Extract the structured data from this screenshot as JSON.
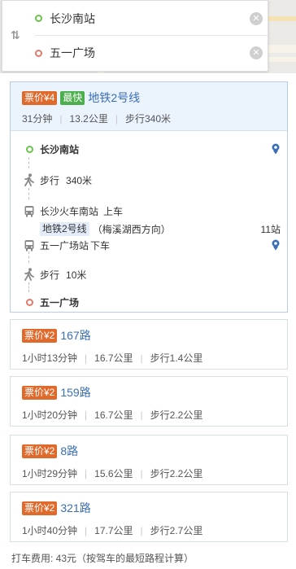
{
  "search": {
    "origin": "长沙南站",
    "destination": "五一广场"
  },
  "selected_route": {
    "price": "票价¥4",
    "fast_tag": "最快",
    "name": "地铁2号线",
    "duration": "31分钟",
    "distance": "13.2公里",
    "walk": "步行340米",
    "steps": {
      "start": "长沙南站",
      "walk1_label": "步行",
      "walk1_dist": "340米",
      "board_station": "长沙火车南站",
      "board_action": "上车",
      "line": "地铁2号线",
      "direction": "（梅溪湖西方向）",
      "stops": "11站",
      "alight_station": "五一广场站",
      "alight_action": "下车",
      "walk2_label": "步行",
      "walk2_dist": "10米",
      "end": "五一广场"
    }
  },
  "routes": [
    {
      "price": "票价¥2",
      "name": "167路",
      "duration": "1小时13分钟",
      "distance": "16.7公里",
      "walk": "步行1.4公里"
    },
    {
      "price": "票价¥2",
      "name": "159路",
      "duration": "1小时20分钟",
      "distance": "16.7公里",
      "walk": "步行2.2公里"
    },
    {
      "price": "票价¥2",
      "name": "8路",
      "duration": "1小时29分钟",
      "distance": "15.6公里",
      "walk": "步行2.2公里"
    },
    {
      "price": "票价¥2",
      "name": "321路",
      "duration": "1小时40分钟",
      "distance": "17.7公里",
      "walk": "步行2.7公里"
    }
  ],
  "taxi_fare": "打车费用: 43元（按驾车的最短路程计算）",
  "icons": {
    "swap": "swap-icon",
    "clear": "clear-icon",
    "walk": "walk-icon",
    "bus": "bus-icon",
    "pin": "location-pin-icon"
  },
  "colors": {
    "price_badge": "#e06a2c",
    "fast_badge": "#4cae4c",
    "link_blue": "#3a6eb5",
    "origin_green": "#6cc24a",
    "destination_red": "#e07a6b"
  }
}
